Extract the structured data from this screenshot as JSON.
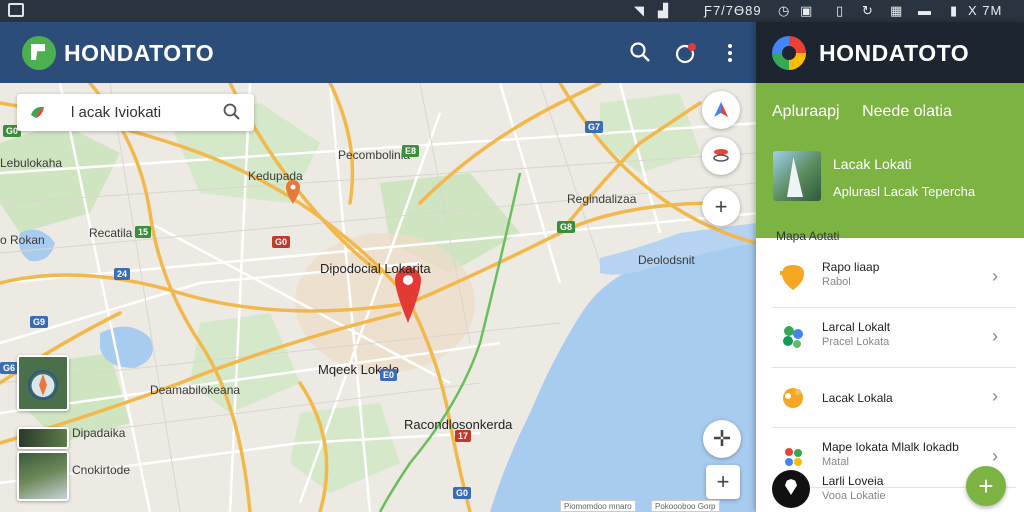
{
  "status_bar": {
    "time_text": "Ƒ7/7Ɵ89",
    "right_text": "X 7M"
  },
  "app_bar": {
    "title": "HONDATOTO"
  },
  "search": {
    "value": "l acak Iviokati"
  },
  "map": {
    "labels": [
      "Pecombolinia",
      "Lebulokaha",
      "Kedupada",
      "Regindalizaa",
      "Recatila",
      "o Rokan",
      "Dipodocial Lokarita",
      "Deolodsnit",
      "Mqeek Lokalo",
      "Deamabilokeana",
      "Dipadaika",
      "Cnokirtode",
      "Racondlosonkerda"
    ],
    "shields": [
      "G0",
      "G7",
      "E8",
      "15",
      "G0",
      "G8",
      "24",
      "G9",
      "G6",
      "17",
      "G0",
      "E0"
    ],
    "attribution": [
      "Piomomdoo mnaro",
      "Pokoooboo Gorp"
    ]
  },
  "panel": {
    "title": "HONDATOTO",
    "tabs": [
      "Apluraapj",
      "Neede olatia"
    ],
    "featured": {
      "title": "Lacak Lokati",
      "subtitle": "Aplurasl Lacak Tepercha"
    },
    "section_title": "Mapa Aotati",
    "items": [
      {
        "title": "Rapo liaap",
        "subtitle": "Rabol",
        "icon": "pin-icon",
        "color": "#f5a623"
      },
      {
        "title": "Larcal Lokalt",
        "subtitle": "Pracel Lokata",
        "icon": "leaf-cluster-icon",
        "color": "#34a853"
      },
      {
        "title": "Lacak Lokala",
        "subtitle": "",
        "icon": "puzzle-icon",
        "color": "#f5a623"
      },
      {
        "title": "Mape Iokata Mlalk Iokadb",
        "subtitle": "Matal",
        "icon": "flower-icon",
        "color": "#ea4335"
      }
    ],
    "bottom": {
      "title": "Larli Loveia",
      "subtitle": "Vooa Lokatie"
    }
  }
}
